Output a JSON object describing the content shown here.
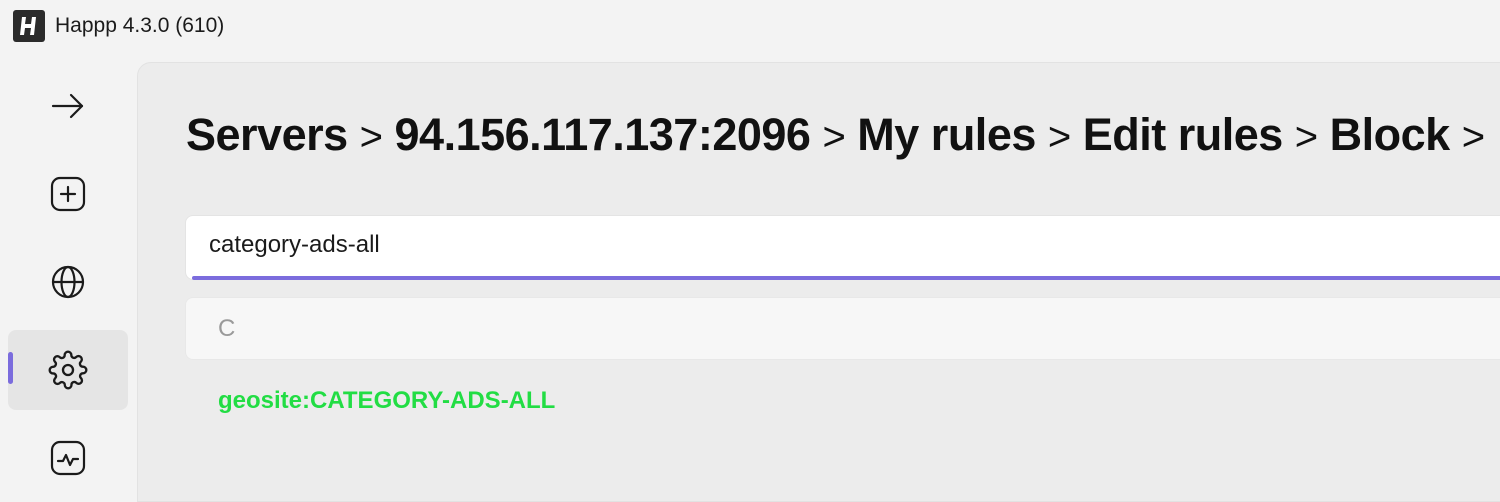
{
  "window": {
    "title": "Happp 4.3.0 (610)"
  },
  "sidebar": {
    "items": [
      {
        "icon": "arrow-right-icon",
        "active": false
      },
      {
        "icon": "add-box-icon",
        "active": false
      },
      {
        "icon": "globe-icon",
        "active": false
      },
      {
        "icon": "gear-icon",
        "active": true
      },
      {
        "icon": "activity-chart-icon",
        "active": false
      }
    ]
  },
  "breadcrumb": {
    "items": [
      "Servers",
      "94.156.117.137:2096",
      "My rules",
      "Edit rules",
      "Block"
    ],
    "separator": ">"
  },
  "rule_input": {
    "value": "category-ads-all"
  },
  "filter_input": {
    "value": "C"
  },
  "results": [
    "geosite:CATEGORY-ADS-ALL"
  ],
  "colors": {
    "accent": "#7b6cdd",
    "result": "#22dd44"
  }
}
